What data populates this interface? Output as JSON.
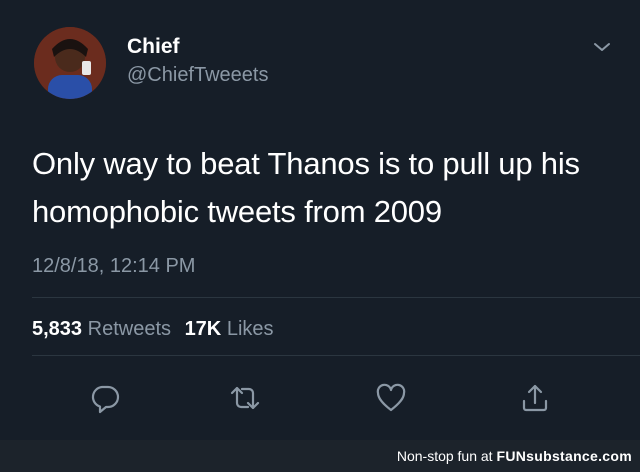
{
  "tweet": {
    "author_name": "Chief",
    "author_handle": "@ChiefTweeets",
    "text_line1": "Only way to beat Thanos is to pull up his",
    "text_line2": "homophobic tweets from 2009",
    "timestamp": "12/8/18, 12:14 PM",
    "retweet_count": "5,833",
    "retweet_label": "Retweets",
    "like_count": "17K",
    "like_label": "Likes"
  },
  "icons": {
    "menu": "chevron-down-icon",
    "reply": "reply-icon",
    "retweet": "retweet-icon",
    "like": "heart-icon",
    "share": "share-icon"
  },
  "footer": {
    "prefix": "Non-stop fun at",
    "brand_part1": "FUN",
    "brand_part2": "substance",
    "brand_suffix": ".com"
  },
  "colors": {
    "background": "#161e28",
    "text": "#ffffff",
    "secondary_text": "#8b98a5",
    "icon": "#8b98a5"
  }
}
